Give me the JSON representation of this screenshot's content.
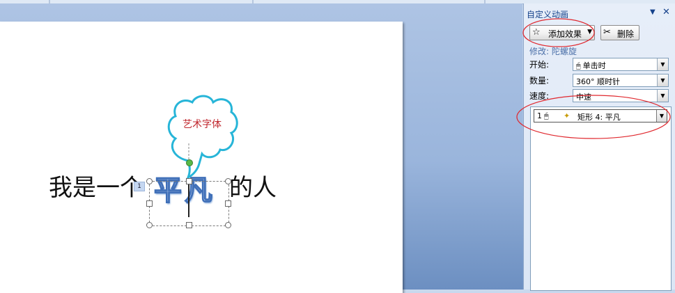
{
  "pane": {
    "title": "自定义动画",
    "dropdown_arrow": "▼",
    "close": "✕",
    "add_effect_label": "添加效果",
    "delete_label": "删除",
    "modify_label": "修改: 陀螺旋",
    "start_label": "开始:",
    "start_value": "单击时",
    "amount_label": "数量:",
    "amount_value": "360°   顺时针",
    "speed_label": "速度:",
    "speed_value": "中速",
    "list": [
      {
        "index": "1",
        "text": "矩形 4: 平凡"
      }
    ]
  },
  "slide": {
    "text_left": "我是一个",
    "art_text": "平凡",
    "text_right": "的人",
    "callout_text": "艺术字体",
    "anim_tag": "1"
  },
  "colors": {
    "callout_outline": "#27b5d8",
    "callout_text": "#c0262d",
    "highlight_ellipse": "#e0282e",
    "art_text_fill": "#e8f0fb",
    "art_text_stroke": "#3f6fb8",
    "pane_title": "#15428b"
  },
  "icons": {
    "add_effect": "star-icon",
    "delete": "delete-icon",
    "start_trigger": "mouse-icon",
    "list_effect": "star-burst-icon"
  }
}
